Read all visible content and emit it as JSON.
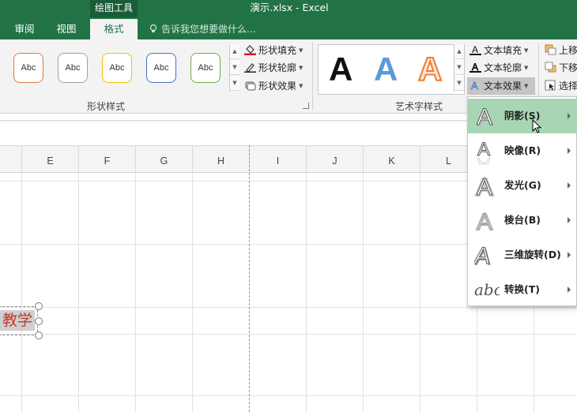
{
  "titlebar": {
    "tool_context": "绘图工具",
    "doc_title": "演示.xlsx - Excel",
    "tabs": [
      {
        "label": "审阅",
        "active": false
      },
      {
        "label": "视图",
        "active": false
      },
      {
        "label": "格式",
        "active": true
      }
    ],
    "tellme": "告诉我您想要做什么..."
  },
  "ribbon": {
    "shape_styles": {
      "presets": [
        {
          "label": "Abc",
          "border": "#e07b39"
        },
        {
          "label": "Abc",
          "border": "#a0a0a0"
        },
        {
          "label": "Abc",
          "border": "#f2c100"
        },
        {
          "label": "Abc",
          "border": "#4472c4"
        },
        {
          "label": "Abc",
          "border": "#70ad47"
        }
      ],
      "fill": "形状填充",
      "outline": "形状轮廓",
      "effects": "形状效果",
      "group_label": "形状样式",
      "fill_color": "#e81123"
    },
    "wordart": {
      "letters": [
        {
          "char": "A",
          "style": "black"
        },
        {
          "char": "A",
          "style": "blue"
        },
        {
          "char": "A",
          "style": "orange"
        }
      ],
      "text_fill": "文本填充",
      "text_outline": "文本轮廓",
      "text_effects": "文本效果",
      "group_label": "艺术字样式"
    },
    "arrange": {
      "bring_forward": "上移",
      "send_backward": "下移",
      "selection_pane": "选择"
    }
  },
  "columns": [
    "E",
    "F",
    "G",
    "H",
    "I",
    "J",
    "K",
    "L"
  ],
  "textbox": {
    "text": "教学",
    "text_color": "#c0392b"
  },
  "menu": {
    "items": [
      {
        "label": "阴影(S)",
        "icon": "shadow-a-icon",
        "highlighted": true
      },
      {
        "label": "映像(R)",
        "icon": "reflection-a-icon",
        "highlighted": false
      },
      {
        "label": "发光(G)",
        "icon": "glow-a-icon",
        "highlighted": false
      },
      {
        "label": "棱台(B)",
        "icon": "bevel-a-icon",
        "highlighted": false
      },
      {
        "label": "三维旋转(D)",
        "icon": "3d-rotation-a-icon",
        "highlighted": false
      },
      {
        "label": "转换(T)",
        "icon": "transform-abc-icon",
        "highlighted": false
      }
    ]
  },
  "colors": {
    "excel_green": "#217346",
    "menu_highlight": "#a8d6b4"
  }
}
